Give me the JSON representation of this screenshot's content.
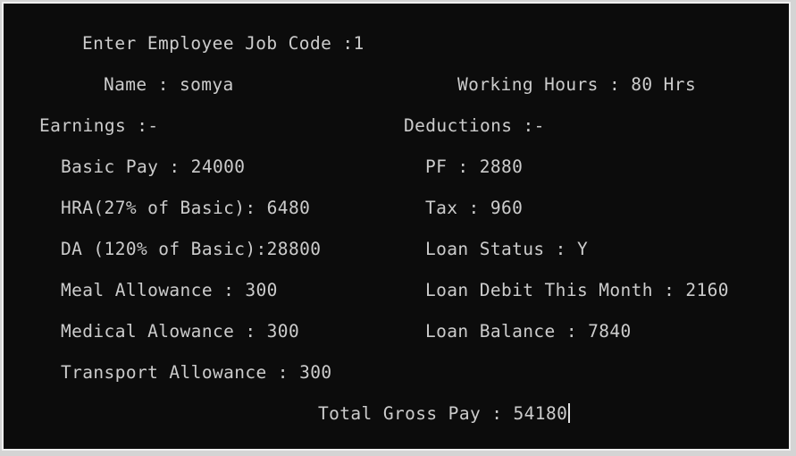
{
  "console": {
    "lines": {
      "job_code": "Enter Employee Job Code :1",
      "name": "Name : somya",
      "working_hours": "Working Hours : 80 Hrs",
      "earnings_header": "Earnings :-",
      "deductions_header": "Deductions :-",
      "basic_pay": "Basic Pay : 24000",
      "pf": "PF : 2880",
      "hra": "HRA(27% of Basic): 6480",
      "tax": "Tax : 960",
      "da": "DA (120% of Basic):28800",
      "loan_status": "Loan Status : Y",
      "meal": "Meal Allowance : 300",
      "loan_debit": "Loan Debit This Month : 2160",
      "medical": "Medical Alowance : 300",
      "loan_balance": "Loan Balance : 7840",
      "transport": "Transport Allowance : 300",
      "total_gross": "Total Gross Pay : 54180"
    },
    "colors": {
      "background": "#0c0c0c",
      "text": "#cccccc"
    }
  }
}
